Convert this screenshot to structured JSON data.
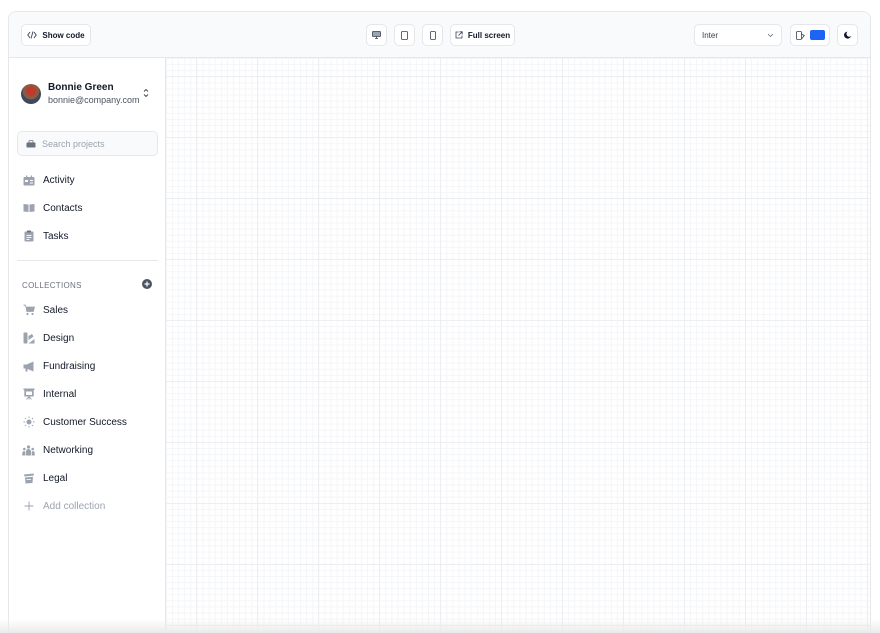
{
  "toolbar": {
    "show_code_label": "Show code",
    "show_code_icon": "code-icon",
    "devices": [
      {
        "name": "desktop",
        "icon": "desktop-icon"
      },
      {
        "name": "tablet",
        "icon": "tablet-icon"
      },
      {
        "name": "mobile",
        "icon": "mobile-icon"
      }
    ],
    "fullscreen_label": "Full screen",
    "fullscreen_icon": "external-link-icon",
    "font_select_value": "Inter",
    "theme_color": "#1c64f2",
    "dark_mode_icon": "moon-icon"
  },
  "sidebar": {
    "user": {
      "name": "Bonnie Green",
      "email": "bonnie@company.com"
    },
    "search_placeholder": "Search projects",
    "nav": [
      {
        "label": "Activity",
        "icon": "activity-icon"
      },
      {
        "label": "Contacts",
        "icon": "book-icon"
      },
      {
        "label": "Tasks",
        "icon": "clipboard-icon"
      }
    ],
    "collections_label": "COLLECTIONS",
    "collections": [
      {
        "label": "Sales",
        "icon": "cart-icon"
      },
      {
        "label": "Design",
        "icon": "design-icon"
      },
      {
        "label": "Fundraising",
        "icon": "megaphone-icon"
      },
      {
        "label": "Internal",
        "icon": "presentation-icon"
      },
      {
        "label": "Customer Success",
        "icon": "lightbulb-icon"
      },
      {
        "label": "Networking",
        "icon": "users-icon"
      },
      {
        "label": "Legal",
        "icon": "scale-icon"
      }
    ],
    "add_collection_label": "Add collection"
  },
  "colors": {
    "accent": "#1c64f2",
    "icon_gray": "#9ca3af",
    "border": "#e5e7eb"
  }
}
